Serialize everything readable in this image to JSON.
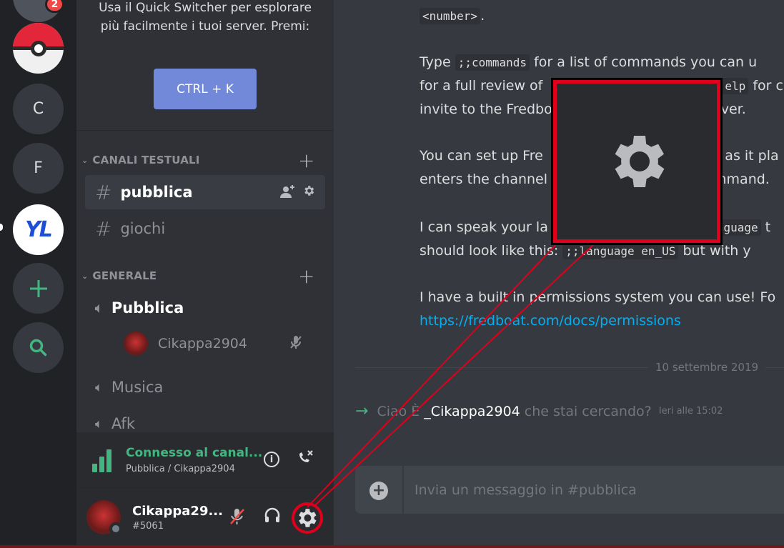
{
  "rail": {
    "badge": "2",
    "server_c": "C",
    "server_f": "F",
    "server_yl": "YL"
  },
  "quick_switcher": {
    "text": "Usa il Quick Switcher per esplorare più facilmente i tuoi server. Premi:",
    "shortcut": "CTRL + K"
  },
  "categories": {
    "text": "CANALI TESTUALI",
    "voice": "GENERALE"
  },
  "text_channels": [
    {
      "name": "pubblica"
    },
    {
      "name": "giochi"
    }
  ],
  "voice_channels": [
    {
      "name": "Pubblica"
    },
    {
      "name": "Musica"
    },
    {
      "name": "Afk"
    }
  ],
  "voice_member": "Cikappa2904",
  "voice_panel": {
    "status": "Connesso al canal...",
    "location": "Pubblica / Cikappa2904"
  },
  "user": {
    "name": "Cikappa29...",
    "tag": "#5061"
  },
  "messages": {
    "line0_code": "<number>",
    "line0_tail": ".",
    "l1_a": "Type ",
    "l1_code": ";;commands",
    "l1_b": " for a list of commands you can u",
    "l2_a": "for a full review of ",
    "l2_code": "elp",
    "l2_b": " for c",
    "l3": "invite to the Fredbo",
    "l3_b": "ver.",
    "l4_a": "You can set up Fre",
    "l4_b": "c as it pla",
    "l5_a": "enters the channel",
    "l5_b": "mmand.",
    "l6_a": "I can speak your la",
    "l6_code": "nguage",
    "l6_b": " t",
    "l7_a": "should look like this: ",
    "l7_code": ";;language en_US",
    "l7_b": " but with y",
    "l8": "I have a built in permissions system you can use! Fo",
    "l9_link": "https://fredboat.com/docs/permissions"
  },
  "date_divider": "10 settembre 2019",
  "system_message": {
    "prefix": "Ciao È",
    "username": "_Cikappa2904",
    "suffix": "che stai cercando?",
    "time": "Ieri alle 15:02"
  },
  "composer": {
    "placeholder": "Invia un messaggio in #pubblica"
  },
  "colors": {
    "highlight": "#e0001b",
    "brand": "#7289da",
    "online_green": "#43b581"
  }
}
